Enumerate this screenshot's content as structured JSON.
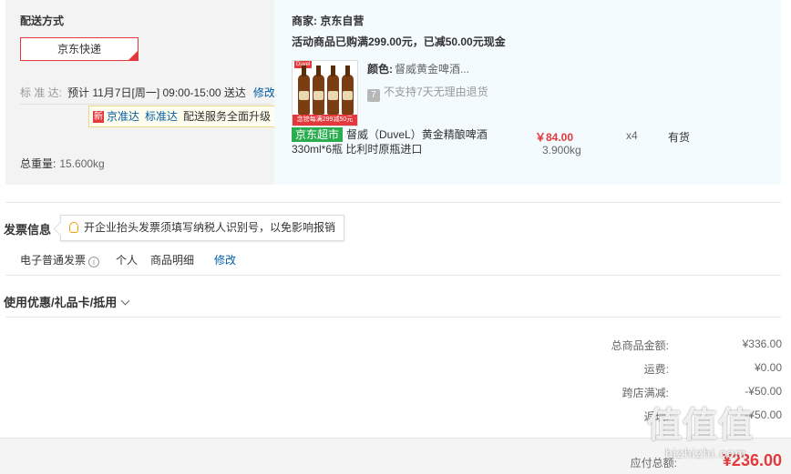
{
  "delivery": {
    "title": "配送方式",
    "method": "京东快递",
    "std_label": "标 准 达:",
    "std_value": "预计 11月7日[周一] 09:00-15:00 送达",
    "edit": "修改",
    "jzd_new": "新",
    "jzd_link1": "京准达",
    "jzd_link2": "标准达",
    "jzd_text": "配送服务全面升级",
    "weight_label": "总重量:",
    "weight_value": "15.600kg"
  },
  "product": {
    "seller_label": "商家:",
    "seller_name": "京东自营",
    "promo": "活动商品已购满299.00元，已减50.00元现金",
    "thumb_badge": "Duvel",
    "thumb_strip": "念镑每满299减50元",
    "color_label": "颜色:",
    "color_value": "督威黄金啤酒...",
    "return_icon": "7",
    "return_text": "不支持7天无理由退货",
    "tag": "京东超市",
    "name": "督威（DuveL）黄金精酿啤酒330ml*6瓶 比利时原瓶进口",
    "price": "￥84.00",
    "weight": "3.900kg",
    "qty": "x4",
    "stock": "有货"
  },
  "invoice": {
    "title": "发票信息",
    "tip": "开企业抬头发票须填写纳税人识别号，以免影响报销",
    "type": "电子普通发票",
    "info_icon": "i",
    "owner": "个人",
    "content": "商品明细",
    "edit": "修改"
  },
  "coupon": {
    "title": "使用优惠/礼品卡/抵用"
  },
  "totals": [
    {
      "label": "总商品金额:",
      "value": "¥336.00"
    },
    {
      "label": "运费:",
      "value": "¥0.00"
    },
    {
      "label": "跨店满减:",
      "value": "-¥50.00"
    },
    {
      "label": "返现:",
      "value": "-¥50.00"
    }
  ],
  "footer": {
    "label": "应付总额:",
    "amount": "¥236.00"
  },
  "watermark": {
    "text": "值值值",
    "url": "hizhizhi.com"
  },
  "colors": {
    "accent": "#e4393c",
    "link": "#005ea7",
    "tag": "#2bad4f"
  }
}
